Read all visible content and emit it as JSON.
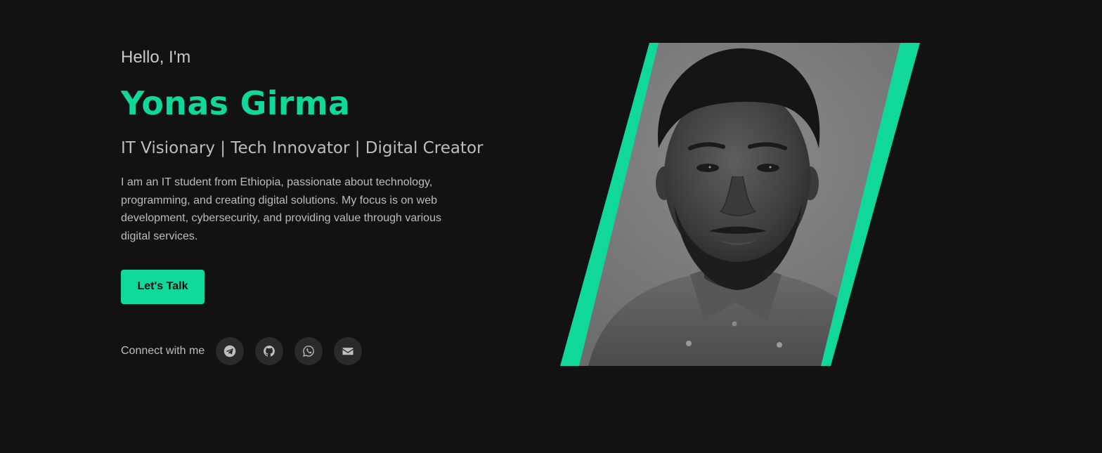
{
  "hero": {
    "greeting": "Hello, I'm",
    "name": "Yonas Girma",
    "tagline": "IT Visionary | Tech Innovator | Digital Creator",
    "bio": "I am an IT student from Ethiopia, passionate about technology, programming, and creating digital solutions. My focus is on web development, cybersecurity, and providing value through various digital services.",
    "cta_label": "Let's Talk"
  },
  "connect": {
    "label": "Connect with me",
    "links": [
      {
        "icon": "telegram-icon",
        "name": "Telegram"
      },
      {
        "icon": "github-icon",
        "name": "GitHub"
      },
      {
        "icon": "whatsapp-icon",
        "name": "WhatsApp"
      },
      {
        "icon": "envelope-icon",
        "name": "Email"
      }
    ]
  },
  "colors": {
    "background": "#121212",
    "accent": "#0fd89a",
    "text": "#bdbdbd",
    "icon_bg": "#2a2a2a",
    "icon_fg": "#bfbfbf"
  },
  "portrait": {
    "description_icon": "portrait-photo"
  }
}
